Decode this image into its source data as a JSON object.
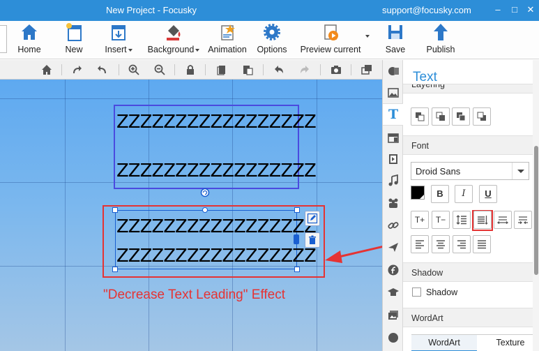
{
  "window": {
    "title": "New Project - Focusky",
    "email": "support@focusky.com"
  },
  "ribbon": {
    "home": "Home",
    "new": "New",
    "insert": "Insert",
    "background": "Background",
    "animation": "Animation",
    "options": "Options",
    "preview": "Preview current",
    "save": "Save",
    "publish": "Publish"
  },
  "canvas": {
    "box1_line1": "ZZZZZZZZZZZZZZZZZ",
    "box1_line2": "ZZZZZZZZZZZZZZZZZ",
    "box2_line1": "ZZZZZZZZZZZZZZZZZ",
    "box2_line2": "ZZZZZZZZZZZZZZZZZ",
    "caption": "\"Decrease Text Leading\" Effect"
  },
  "panel": {
    "title": "Text",
    "layering_partial": "Layering",
    "font_section": "Font",
    "font_name": "Droid Sans",
    "bold": "B",
    "italic": "I",
    "underline": "U",
    "font_inc": "T+",
    "font_dec": "T−",
    "shadow_section": "Shadow",
    "shadow_label": "Shadow",
    "wordart_section": "WordArt",
    "tab_wordart": "WordArt",
    "tab_texture": "Texture"
  },
  "colors": {
    "accent": "#2d8ed8",
    "annotation": "#e53333",
    "selection": "#1a5fd0"
  }
}
